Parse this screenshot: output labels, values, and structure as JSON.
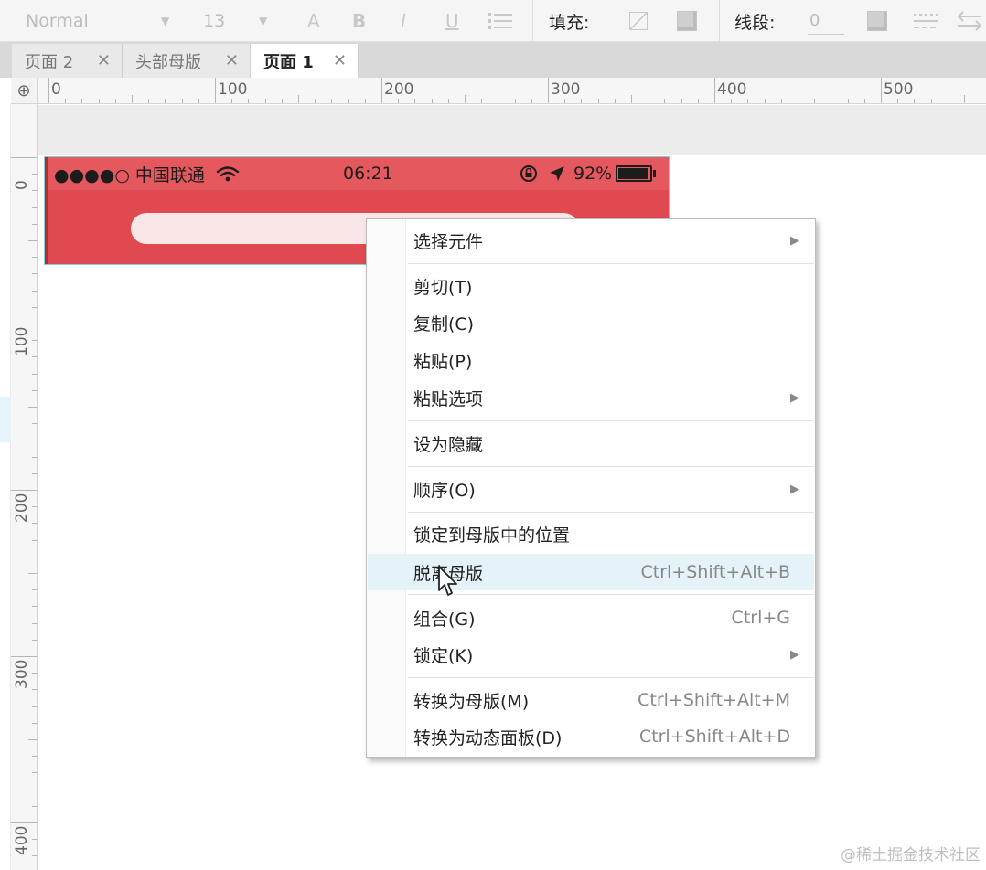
{
  "toolbar": {
    "font_style": "Normal",
    "font_size": "13",
    "btn_font_color": "A",
    "btn_bold": "B",
    "btn_italic": "I",
    "btn_underline": "U",
    "fill_label": "填充:",
    "line_label": "线段:",
    "line_width": "0"
  },
  "tabs": [
    {
      "label": "页面 2",
      "active": false
    },
    {
      "label": "头部母版",
      "active": false
    },
    {
      "label": "页面 1",
      "active": true
    }
  ],
  "ruler": {
    "horizontal": [
      "0",
      "100",
      "200",
      "300",
      "400",
      "500"
    ],
    "vertical": [
      "0",
      "100",
      "200",
      "300",
      "400"
    ]
  },
  "phone_status": {
    "carrier": "●●●●○ 中国联通",
    "time": "06:21",
    "battery": "92%",
    "battery_level": 0.92
  },
  "context_menu": {
    "items": [
      {
        "label": "选择元件",
        "shortcut": "",
        "submenu": true
      },
      {
        "label": "剪切(T)",
        "shortcut": "",
        "submenu": false
      },
      {
        "label": "复制(C)",
        "shortcut": "",
        "submenu": false
      },
      {
        "label": "粘贴(P)",
        "shortcut": "",
        "submenu": false
      },
      {
        "label": "粘贴选项",
        "shortcut": "",
        "submenu": true
      },
      {
        "label": "设为隐藏",
        "shortcut": "",
        "submenu": false
      },
      {
        "label": "顺序(O)",
        "shortcut": "",
        "submenu": true
      },
      {
        "label": "锁定到母版中的位置",
        "shortcut": "",
        "submenu": false
      },
      {
        "label": "脱离母版",
        "shortcut": "Ctrl+Shift+Alt+B",
        "submenu": false,
        "hover": true
      },
      {
        "label": "组合(G)",
        "shortcut": "Ctrl+G",
        "submenu": false
      },
      {
        "label": "锁定(K)",
        "shortcut": "",
        "submenu": true
      },
      {
        "label": "转换为母版(M)",
        "shortcut": "Ctrl+Shift+Alt+M",
        "submenu": false
      },
      {
        "label": "转换为动态面板(D)",
        "shortcut": "Ctrl+Shift+Alt+D",
        "submenu": false
      }
    ]
  },
  "watermark": "@稀土掘金技术社区",
  "colors": {
    "header_red": "#e0494f",
    "menu_hover": "#e5f3f8",
    "selection_outline": "#7fd0d8"
  }
}
